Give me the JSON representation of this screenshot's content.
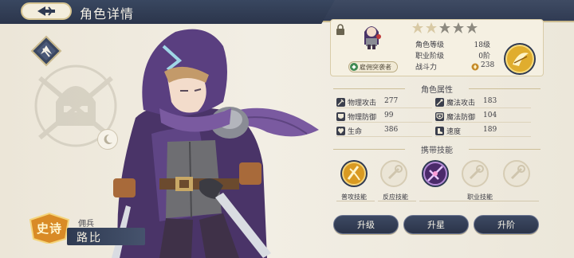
{
  "header": {
    "title": "角色详情"
  },
  "character": {
    "rarity": "史诗",
    "type": "佣兵",
    "name": "路比",
    "profession_tag": "雇佣突袭者",
    "level_label": "角色等级",
    "level_value": "18级",
    "job_stage_label": "职业阶级",
    "job_stage_value": "0阶",
    "power_label": "战斗力",
    "power_value": "238",
    "stars_total": 5,
    "stars_filled": 2
  },
  "attributes": {
    "title": "角色属性",
    "items": [
      {
        "label": "物理攻击",
        "value": "277",
        "icon": "sword-icon"
      },
      {
        "label": "魔法攻击",
        "value": "183",
        "icon": "wand-icon"
      },
      {
        "label": "物理防御",
        "value": "99",
        "icon": "shield-icon"
      },
      {
        "label": "魔法防御",
        "value": "104",
        "icon": "magic-shield-icon"
      },
      {
        "label": "生命",
        "value": "386",
        "icon": "heart-icon"
      },
      {
        "label": "速度",
        "value": "189",
        "icon": "boot-icon"
      }
    ]
  },
  "skills": {
    "title": "携带技能",
    "labels": {
      "normal": "普攻技能",
      "reaction": "反应技能",
      "job": "职业技能"
    }
  },
  "actions": {
    "level_up": "升级",
    "star_up": "升星",
    "rank_up": "升阶"
  },
  "colors": {
    "accent_navy": "#2f3a52",
    "gold": "#d4a52a",
    "parchment": "#f5f0e2"
  }
}
